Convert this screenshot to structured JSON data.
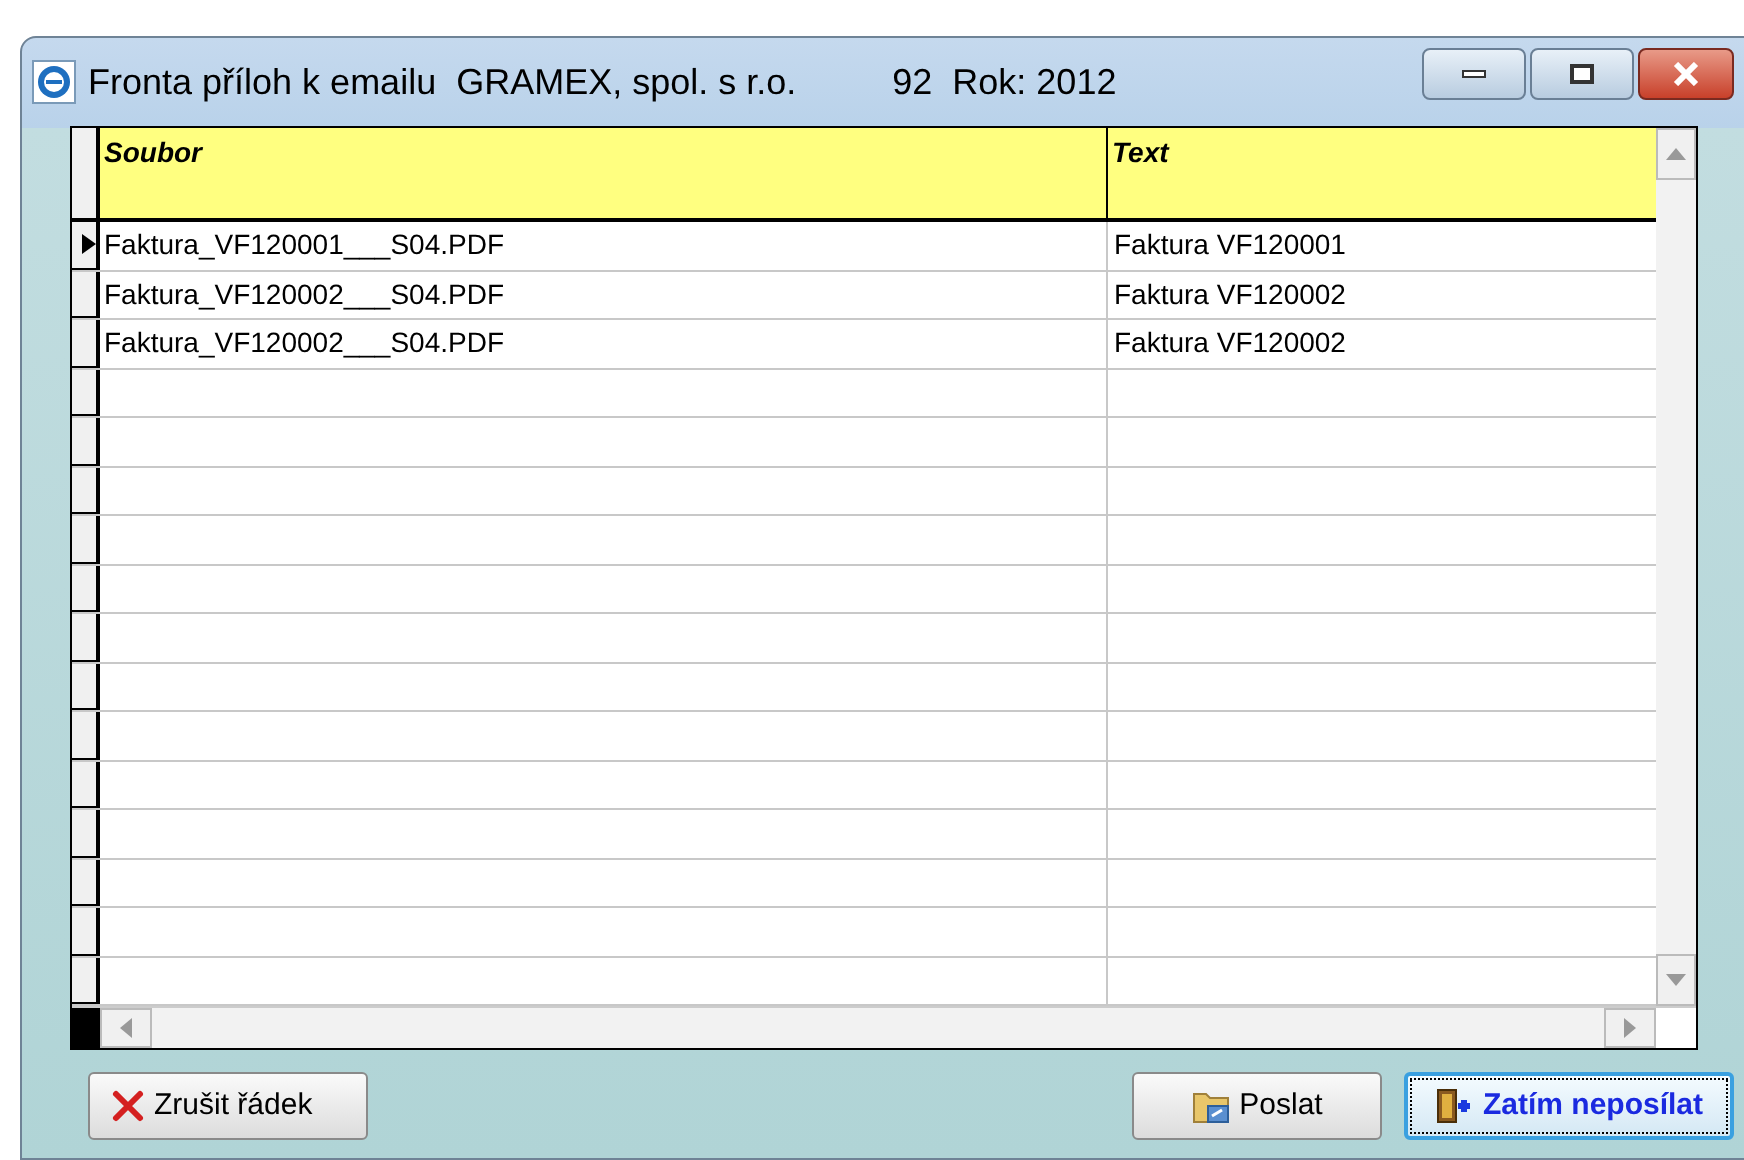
{
  "window": {
    "title": "Fronta příloh k emailu  GRAMEX, spol. s r.o.",
    "title_info": "92  Rok: 2012"
  },
  "table": {
    "columns": [
      "Soubor",
      "Text"
    ],
    "rows": [
      {
        "selected": true,
        "cells": [
          "Faktura_VF120001___S04.PDF",
          "Faktura VF120001"
        ]
      },
      {
        "selected": false,
        "cells": [
          "Faktura_VF120002___S04.PDF",
          "Faktura VF120002"
        ]
      },
      {
        "selected": false,
        "cells": [
          "Faktura_VF120002___S04.PDF",
          "Faktura VF120002"
        ]
      }
    ]
  },
  "buttons": [
    {
      "kind": "delete",
      "label": "Zrušit řádek",
      "focused": false
    },
    {
      "kind": "send",
      "label": "Poslat",
      "focused": false
    },
    {
      "kind": "later",
      "label": "Zatím neposílat",
      "focused": true
    }
  ]
}
